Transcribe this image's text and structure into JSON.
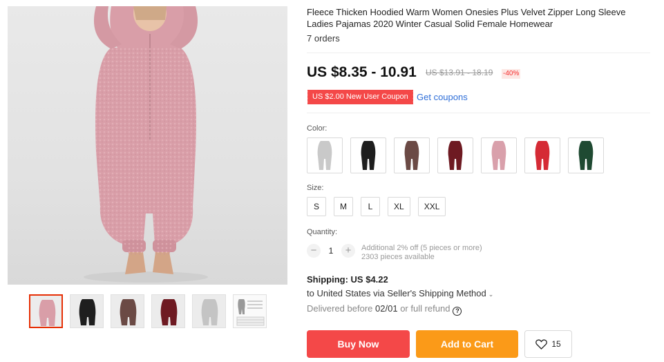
{
  "product": {
    "title": "Fleece Thicken Hoodied Warm Women Onesies Plus Velvet Zipper Long Sleeve Ladies Pajamas 2020 Winter Casual Solid Female Homewear",
    "orders": "7 orders",
    "price": "US $8.35 - 10.91",
    "old_price": "US $13.91 - 18.19",
    "discount": "-40%",
    "coupon": "US $2.00 New User Coupon",
    "get_coupons": "Get coupons"
  },
  "options": {
    "color_label": "Color:",
    "colors": [
      {
        "name": "gray",
        "hex": "#c9c9c9"
      },
      {
        "name": "black",
        "hex": "#1e1e1e"
      },
      {
        "name": "brown",
        "hex": "#6b4a45"
      },
      {
        "name": "wine",
        "hex": "#6e1a22"
      },
      {
        "name": "pink",
        "hex": "#d9a0ab"
      },
      {
        "name": "red",
        "hex": "#d52b35"
      },
      {
        "name": "green",
        "hex": "#1f4a32"
      }
    ],
    "size_label": "Size:",
    "sizes": [
      "S",
      "M",
      "L",
      "XL",
      "XXL"
    ],
    "quantity_label": "Quantity:",
    "quantity_minus": "−",
    "quantity_value": "1",
    "quantity_plus": "+",
    "quantity_note": "Additional 2% off (5 pieces or more)",
    "quantity_available": "2303 pieces available"
  },
  "shipping": {
    "title": "Shipping: US $4.22",
    "to": "to United States via Seller's Shipping Method",
    "chevron": "⌄",
    "delivered_prefix": "Delivered before",
    "delivered_date": "02/01",
    "delivered_suffix": "or full refund",
    "help": "?"
  },
  "actions": {
    "buy_now": "Buy Now",
    "add_to_cart": "Add to Cart",
    "wishlist_count": "15"
  },
  "colors": {
    "accent_red": "#f44848",
    "accent_orange": "#fb9a18",
    "link_blue": "#2e6ed8",
    "main_garment": "#d99ea8"
  },
  "gallery": {
    "thumbs": [
      "pink",
      "black",
      "brown",
      "wine",
      "gray",
      "size-chart"
    ]
  }
}
